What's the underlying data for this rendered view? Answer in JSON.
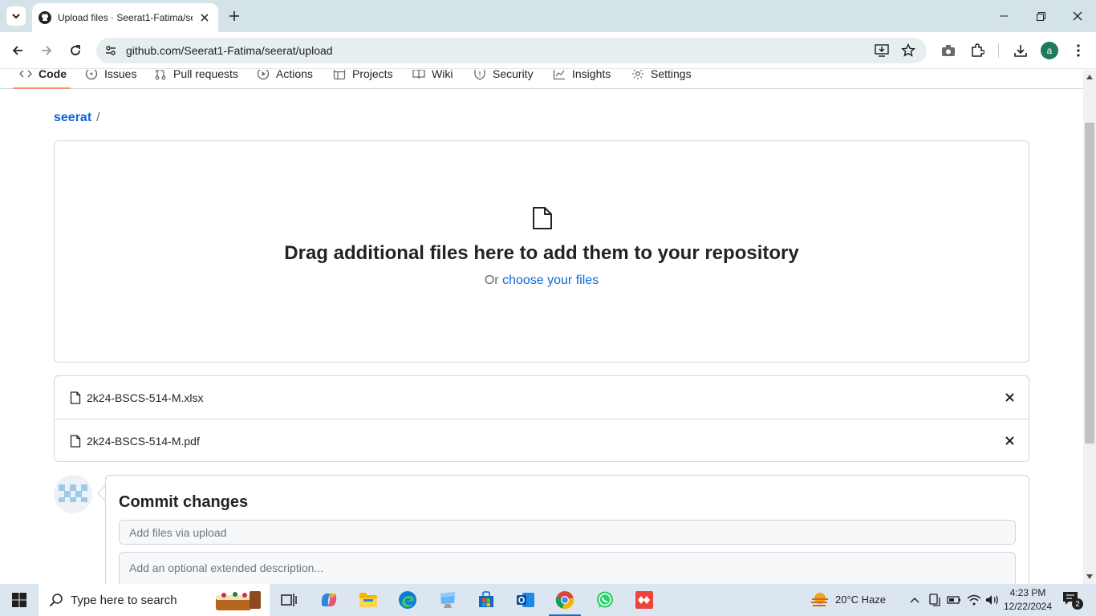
{
  "browser": {
    "tab_title": "Upload files · Seerat1-Fatima/seerat",
    "url": "github.com/Seerat1-Fatima/seerat/upload",
    "profile_initial": "a"
  },
  "repo_nav": {
    "items": [
      {
        "label": "Code",
        "icon": "code-icon",
        "selected": true
      },
      {
        "label": "Issues",
        "icon": "issue-icon"
      },
      {
        "label": "Pull requests",
        "icon": "pull-request-icon"
      },
      {
        "label": "Actions",
        "icon": "play-icon"
      },
      {
        "label": "Projects",
        "icon": "table-icon"
      },
      {
        "label": "Wiki",
        "icon": "book-icon"
      },
      {
        "label": "Security",
        "icon": "shield-icon"
      },
      {
        "label": "Insights",
        "icon": "graph-icon"
      },
      {
        "label": "Settings",
        "icon": "gear-icon"
      }
    ]
  },
  "breadcrumb": {
    "repo": "seerat",
    "separator": "/"
  },
  "dropzone": {
    "title": "Drag additional files here to add them to your repository",
    "prefix": "Or",
    "link": "choose your files"
  },
  "files": [
    {
      "name": "2k24-BSCS-514-M.xlsx"
    },
    {
      "name": "2k24-BSCS-514-M.pdf"
    }
  ],
  "commit": {
    "title": "Commit changes",
    "summary_placeholder": "Add files via upload",
    "description_placeholder": "Add an optional extended description..."
  },
  "taskbar": {
    "search_placeholder": "Type here to search",
    "weather": "20°C  Haze",
    "time": "4:23 PM",
    "date": "12/22/2024",
    "notification_count": "2"
  },
  "colors": {
    "link": "#0969da",
    "accent_underline": "#fd8c73",
    "border": "#d0d7de"
  }
}
